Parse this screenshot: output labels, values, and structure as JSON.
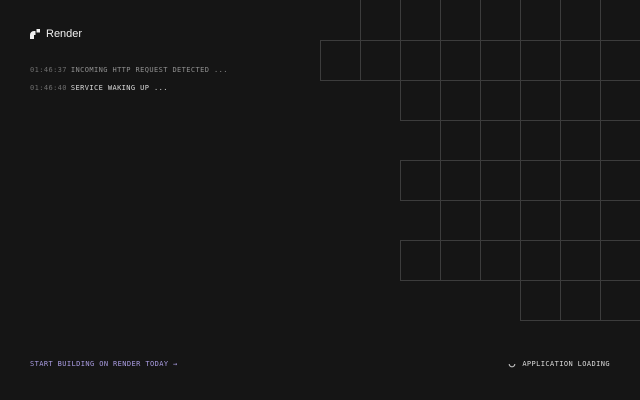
{
  "brand": {
    "name": "Render",
    "icon": "render-logo-icon"
  },
  "log": [
    {
      "time": "01:46:37",
      "text": "INCOMING HTTP REQUEST DETECTED ..."
    },
    {
      "time": "01:46:40",
      "text": "SERVICE WAKING UP ..."
    }
  ],
  "footer": {
    "cta_label": "START BUILDING ON RENDER TODAY →",
    "status_label": "APPLICATION LOADING",
    "status_icon": "spinner-icon"
  },
  "colors": {
    "background": "#151515",
    "accent": "#a89be0",
    "grid_line": "#3c3c3c"
  }
}
